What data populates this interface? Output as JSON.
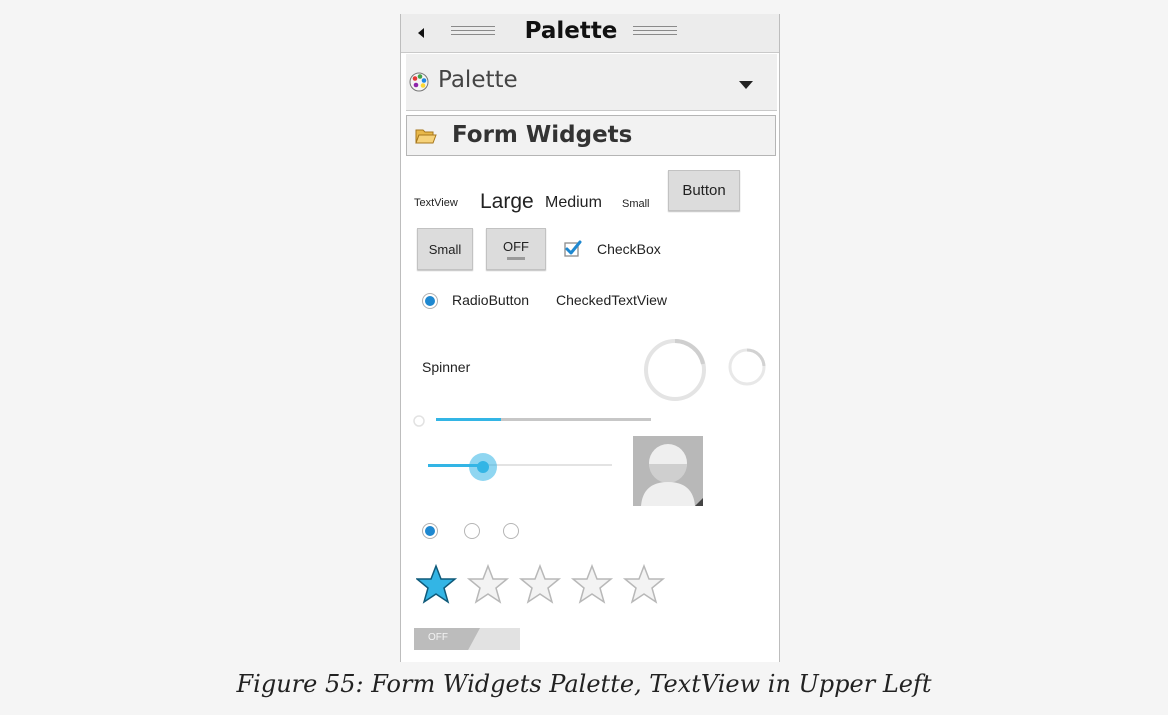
{
  "palette_view": {
    "title": "Palette",
    "selector_label": "Palette",
    "category": "Form Widgets"
  },
  "widgets": {
    "textview": "TextView",
    "large": "Large",
    "medium": "Medium",
    "small": "Small",
    "button": "Button",
    "small_button": "Small",
    "toggle_button": "OFF",
    "checkbox": "CheckBox",
    "radio_button": "RadioButton",
    "checked_textview": "CheckedTextView",
    "spinner": "Spinner",
    "switch": "OFF",
    "checkbox_checked": true,
    "radio_checked": true,
    "progress_fraction": 0.3,
    "seekbar_fraction": 0.3,
    "rating_stars_filled": 1,
    "rating_stars_total": 5,
    "radio_group_selected_index": 0,
    "radio_group_count": 3
  },
  "caption": "Figure 55: Form Widgets Palette, TextView in Upper Left",
  "colors": {
    "holo_blue": "#33b5e5",
    "check_blue": "#1e88d0"
  }
}
